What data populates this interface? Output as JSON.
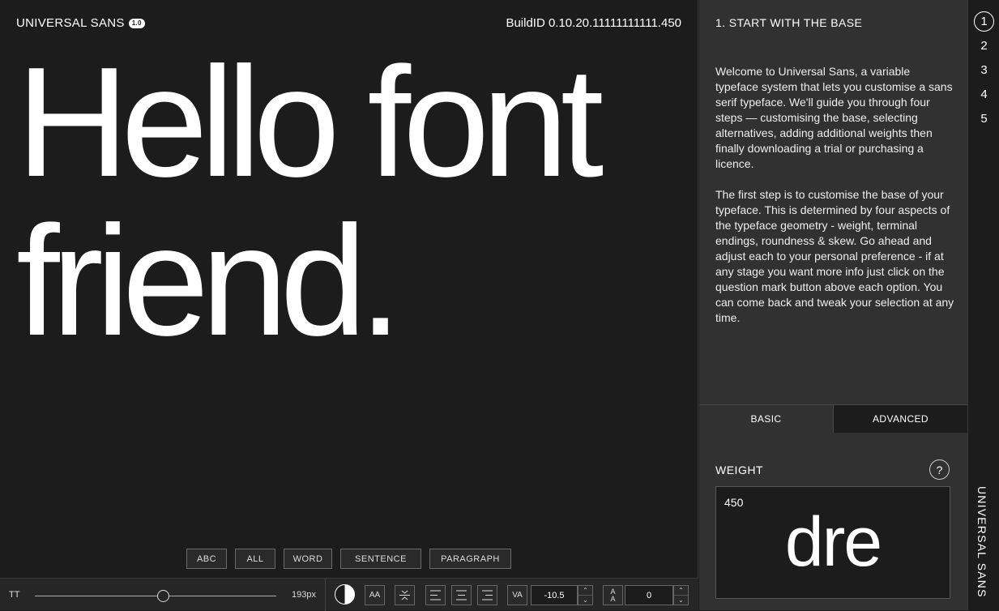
{
  "app": {
    "brand": "UNIVERSAL SANS",
    "version_badge": "1.0",
    "build": "BuildID 0.10.20.11111111111.450"
  },
  "preview": {
    "text": "Hello font friend."
  },
  "modes": [
    "ABC",
    "ALL",
    "WORD",
    "SENTENCE",
    "PARAGRAPH"
  ],
  "toolbar": {
    "tt_label": "TT",
    "size_value": "193px",
    "size_fraction": 0.53,
    "case_label": "AA",
    "tracking_label": "VA",
    "tracking_value": "-10.5",
    "leading_label_top": "A",
    "leading_label_bottom": "A",
    "leading_value": "0",
    "stepper_up": "⌃",
    "stepper_down": "⌄"
  },
  "panel": {
    "heading": "1. START WITH THE BASE",
    "intro_p1": "Welcome to Universal Sans, a variable typeface system that lets you customise a sans serif typeface. We'll guide you through four steps — customising the base, selecting alternatives, adding additional weights then finally downloading a trial or purchasing a licence.",
    "intro_p2": "The first step is to customise the base of your typeface. This is determined by four aspects of the typeface geometry - weight, terminal endings, roundness & skew. Go ahead and adjust each to your personal preference - if at any stage you want more info just click on the question mark button above each option. You can come back and tweak your selection at any time.",
    "tabs": [
      "BASIC",
      "ADVANCED"
    ],
    "weight_label": "WEIGHT",
    "help_symbol": "?",
    "weight_value": "450",
    "weight_sample": "dre"
  },
  "rail": {
    "steps": [
      "1",
      "2",
      "3",
      "4",
      "5"
    ],
    "active_step": "1",
    "brand_vertical": "UNIVERSAL SANS"
  }
}
